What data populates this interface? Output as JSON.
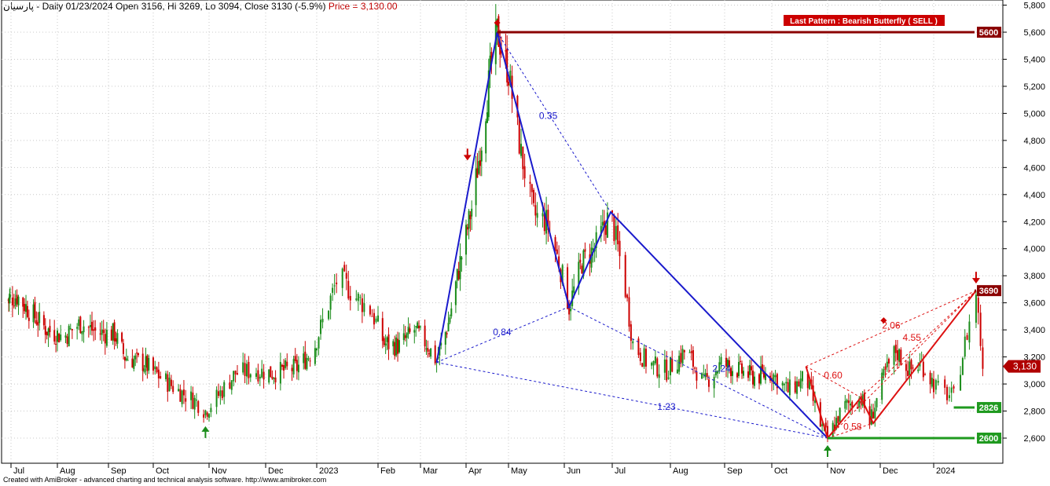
{
  "header": {
    "symbol": "پارسیان",
    "info": " - Daily 01/23/2024 Open 3156, Hi 3269, Lo 3094, Close 3130 (-5.9%)",
    "price": " Price = 3,130.00"
  },
  "footer": {
    "text": "Created with AmiBroker - advanced charting and technical analysis software. http://www.amibroker.com"
  },
  "banner": {
    "text": "Last Pattern : Bearish Butterfly ( SELL )",
    "color": "#cc0000"
  },
  "colors": {
    "up": "#1a8c1a",
    "down": "#cc0000",
    "pattern_blue": "#1a1acc",
    "pattern_red": "#dd1111",
    "level_red": "#8b0000",
    "level_green": "#1f9a1f"
  },
  "chart_data": {
    "type": "candlestick",
    "title": "",
    "ylim": [
      2400,
      5800
    ],
    "y_ticks": [
      "5,800",
      "5,600",
      "5,400",
      "5,200",
      "5,000",
      "4,800",
      "4,600",
      "4,400",
      "4,200",
      "4,000",
      "3,800",
      "3,600",
      "3,400",
      "3,200",
      "3,000",
      "2,800",
      "2,600"
    ],
    "y_tick_values": [
      5800,
      5600,
      5400,
      5200,
      5000,
      4800,
      4600,
      4400,
      4200,
      4000,
      3800,
      3600,
      3400,
      3200,
      3000,
      2800,
      2600
    ],
    "x_months": [
      {
        "label": "Jul",
        "date": "2022-07-01"
      },
      {
        "label": "Aug",
        "date": "2022-08-01"
      },
      {
        "label": "Sep",
        "date": "2022-09-01"
      },
      {
        "label": "Oct",
        "date": "2022-10-01"
      },
      {
        "label": "Nov",
        "date": "2022-11-01"
      },
      {
        "label": "Dec",
        "date": "2022-12-01"
      },
      {
        "label": "2023",
        "date": "2023-01-01"
      },
      {
        "label": "Feb",
        "date": "2023-02-01"
      },
      {
        "label": "Mar",
        "date": "2023-03-01"
      },
      {
        "label": "Apr",
        "date": "2023-04-01"
      },
      {
        "label": "May",
        "date": "2023-05-01"
      },
      {
        "label": "Jun",
        "date": "2023-06-01"
      },
      {
        "label": "Jul",
        "date": "2023-07-01"
      },
      {
        "label": "Aug",
        "date": "2023-08-01"
      },
      {
        "label": "Sep",
        "date": "2023-09-01"
      },
      {
        "label": "Oct",
        "date": "2023-10-01"
      },
      {
        "label": "Nov",
        "date": "2023-11-01"
      },
      {
        "label": "Dec",
        "date": "2023-12-01"
      },
      {
        "label": "2024",
        "date": "2024-01-01"
      }
    ],
    "close_series": [
      {
        "x": "2022-06-25",
        "y": 3620
      },
      {
        "x": "2022-07-05",
        "y": 3650
      },
      {
        "x": "2022-07-15",
        "y": 3520
      },
      {
        "x": "2022-07-25",
        "y": 3400
      },
      {
        "x": "2022-08-05",
        "y": 3350
      },
      {
        "x": "2022-08-15",
        "y": 3450
      },
      {
        "x": "2022-08-25",
        "y": 3380
      },
      {
        "x": "2022-09-05",
        "y": 3370
      },
      {
        "x": "2022-09-12",
        "y": 3200
      },
      {
        "x": "2022-09-25",
        "y": 3150
      },
      {
        "x": "2022-10-05",
        "y": 3050
      },
      {
        "x": "2022-10-15",
        "y": 2950
      },
      {
        "x": "2022-10-25",
        "y": 2870
      },
      {
        "x": "2022-10-30",
        "y": 2800
      },
      {
        "x": "2022-11-05",
        "y": 2900
      },
      {
        "x": "2022-11-15",
        "y": 3080
      },
      {
        "x": "2022-11-25",
        "y": 3100
      },
      {
        "x": "2022-12-05",
        "y": 3080
      },
      {
        "x": "2022-12-20",
        "y": 3120
      },
      {
        "x": "2022-12-30",
        "y": 3250
      },
      {
        "x": "2023-01-05",
        "y": 3500
      },
      {
        "x": "2023-01-12",
        "y": 3800
      },
      {
        "x": "2023-01-20",
        "y": 3650
      },
      {
        "x": "2023-01-28",
        "y": 3550
      },
      {
        "x": "2023-02-05",
        "y": 3300
      },
      {
        "x": "2023-02-15",
        "y": 3280
      },
      {
        "x": "2023-02-25",
        "y": 3400
      },
      {
        "x": "2023-03-05",
        "y": 3300
      },
      {
        "x": "2023-03-12",
        "y": 3170
      },
      {
        "x": "2023-03-20",
        "y": 3450
      },
      {
        "x": "2023-03-28",
        "y": 3900
      },
      {
        "x": "2023-04-05",
        "y": 4300
      },
      {
        "x": "2023-04-12",
        "y": 4800
      },
      {
        "x": "2023-04-18",
        "y": 5300
      },
      {
        "x": "2023-04-23",
        "y": 5600
      },
      {
        "x": "2023-05-01",
        "y": 5300
      },
      {
        "x": "2023-05-08",
        "y": 4700
      },
      {
        "x": "2023-05-15",
        "y": 4250
      },
      {
        "x": "2023-05-22",
        "y": 4200
      },
      {
        "x": "2023-05-29",
        "y": 3900
      },
      {
        "x": "2023-06-04",
        "y": 3570
      },
      {
        "x": "2023-06-12",
        "y": 3900
      },
      {
        "x": "2023-06-20",
        "y": 4000
      },
      {
        "x": "2023-06-30",
        "y": 4270
      },
      {
        "x": "2023-07-07",
        "y": 3800
      },
      {
        "x": "2023-07-12",
        "y": 3300
      },
      {
        "x": "2023-07-20",
        "y": 3150
      },
      {
        "x": "2023-07-30",
        "y": 3100
      },
      {
        "x": "2023-08-10",
        "y": 3250
      },
      {
        "x": "2023-08-20",
        "y": 3000
      },
      {
        "x": "2023-08-30",
        "y": 3150
      },
      {
        "x": "2023-09-10",
        "y": 3100
      },
      {
        "x": "2023-09-20",
        "y": 3050
      },
      {
        "x": "2023-10-01",
        "y": 3080
      },
      {
        "x": "2023-10-10",
        "y": 2950
      },
      {
        "x": "2023-10-20",
        "y": 3050
      },
      {
        "x": "2023-10-28",
        "y": 2700
      },
      {
        "x": "2023-11-01",
        "y": 2600
      },
      {
        "x": "2023-11-10",
        "y": 2830
      },
      {
        "x": "2023-11-20",
        "y": 2900
      },
      {
        "x": "2023-11-25",
        "y": 2720
      },
      {
        "x": "2023-12-03",
        "y": 3050
      },
      {
        "x": "2023-12-10",
        "y": 3250
      },
      {
        "x": "2023-12-18",
        "y": 3100
      },
      {
        "x": "2023-12-25",
        "y": 3150
      },
      {
        "x": "2024-01-03",
        "y": 2960
      },
      {
        "x": "2024-01-10",
        "y": 2900
      },
      {
        "x": "2024-01-15",
        "y": 3300
      },
      {
        "x": "2024-01-20",
        "y": 3680
      },
      {
        "x": "2024-01-23",
        "y": 3130
      }
    ],
    "pattern_blue_points": [
      {
        "x": "2023-03-12",
        "y": 3160
      },
      {
        "x": "2023-04-23",
        "y": 5600
      },
      {
        "x": "2023-06-04",
        "y": 3570
      },
      {
        "x": "2023-06-30",
        "y": 4270
      },
      {
        "x": "2023-11-01",
        "y": 2600
      }
    ],
    "pattern_blue_dashed": [
      [
        {
          "x": "2023-03-12",
          "y": 3160
        },
        {
          "x": "2023-06-04",
          "y": 3570
        }
      ],
      [
        {
          "x": "2023-04-23",
          "y": 5600
        },
        {
          "x": "2023-06-30",
          "y": 4270
        }
      ],
      [
        {
          "x": "2023-06-04",
          "y": 3570
        },
        {
          "x": "2023-11-01",
          "y": 2600
        }
      ],
      [
        {
          "x": "2023-03-12",
          "y": 3160
        },
        {
          "x": "2023-11-01",
          "y": 2600
        }
      ],
      [
        {
          "x": "2023-06-30",
          "y": 4270
        },
        {
          "x": "2023-11-01",
          "y": 2600
        }
      ]
    ],
    "pattern_red_points": [
      {
        "x": "2023-10-20",
        "y": 3130
      },
      {
        "x": "2023-11-01",
        "y": 2600
      },
      {
        "x": "2023-11-20",
        "y": 2900
      },
      {
        "x": "2023-11-27",
        "y": 2710
      },
      {
        "x": "2024-01-20",
        "y": 3690
      }
    ],
    "pattern_red_dashed": [
      [
        {
          "x": "2023-10-20",
          "y": 3130
        },
        {
          "x": "2023-11-20",
          "y": 2900
        }
      ],
      [
        {
          "x": "2023-11-01",
          "y": 2600
        },
        {
          "x": "2023-11-27",
          "y": 2710
        }
      ],
      [
        {
          "x": "2023-10-20",
          "y": 3130
        },
        {
          "x": "2024-01-20",
          "y": 3690
        }
      ],
      [
        {
          "x": "2023-11-20",
          "y": 2900
        },
        {
          "x": "2024-01-20",
          "y": 3690
        }
      ],
      [
        {
          "x": "2023-11-01",
          "y": 2600
        },
        {
          "x": "2024-01-20",
          "y": 3690
        }
      ]
    ],
    "ratio_labels": [
      {
        "text": "0.35",
        "x": "2023-05-18",
        "y": 4960,
        "color": "blue"
      },
      {
        "text": "0.84",
        "x": "2023-04-20",
        "y": 3360,
        "color": "blue"
      },
      {
        "text": "2.24",
        "x": "2023-08-25",
        "y": 3090,
        "color": "blue"
      },
      {
        "text": "1.23",
        "x": "2023-07-25",
        "y": 2810,
        "color": "blue"
      },
      {
        "text": "0.60",
        "x": "2023-10-30",
        "y": 3040,
        "color": "red"
      },
      {
        "text": "0.58",
        "x": "2023-11-10",
        "y": 2660,
        "color": "red"
      },
      {
        "text": "2.06",
        "x": "2023-12-02",
        "y": 3410,
        "color": "red"
      },
      {
        "text": "4.55",
        "x": "2023-12-14",
        "y": 3320,
        "color": "red"
      }
    ],
    "levels": [
      {
        "label": "5600",
        "y": 5600,
        "kind": "red",
        "from": "2023-04-23"
      },
      {
        "label": "3690",
        "y": 3690,
        "kind": "red",
        "from": "2024-01-20"
      },
      {
        "label": "2826",
        "y": 2826,
        "kind": "green",
        "from": "2024-01-10"
      },
      {
        "label": "2600",
        "y": 2600,
        "kind": "green",
        "from": "2023-11-01"
      }
    ],
    "last_price": {
      "label": "3,130",
      "y": 3130
    },
    "signal_arrows": [
      {
        "dir": "down",
        "x": "2023-04-23",
        "y": 5600,
        "shape": "diamond"
      },
      {
        "dir": "down",
        "x": "2023-04-02",
        "y": 4600,
        "shape": "arrow"
      },
      {
        "dir": "up",
        "x": "2022-10-30",
        "y": 2740,
        "shape": "arrow"
      },
      {
        "dir": "up",
        "x": "2023-11-01",
        "y": 2600,
        "shape": "arrow"
      },
      {
        "dir": "down",
        "x": "2024-01-20",
        "y": 3690,
        "shape": "arrow"
      },
      {
        "dir": "down",
        "x": "2023-12-03",
        "y": 3400,
        "shape": "diamond"
      }
    ]
  }
}
